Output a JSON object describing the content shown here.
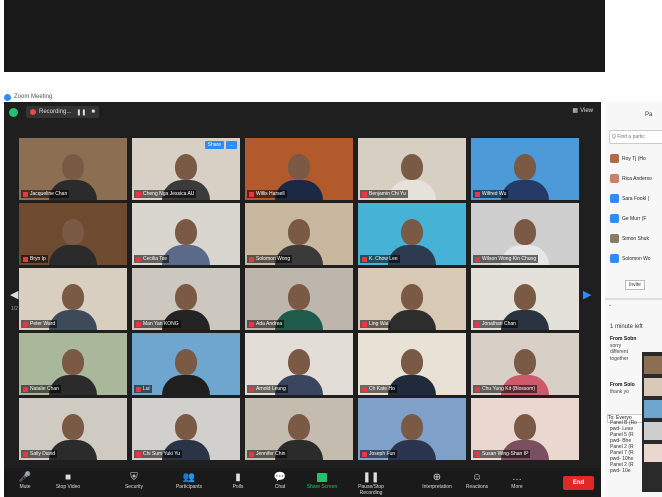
{
  "app": {
    "title": "Zoom Meeting"
  },
  "status": {
    "recording_label": "Recording...",
    "pause": "❚❚",
    "stop": "■",
    "view_label": "View"
  },
  "nav": {
    "left": "◀",
    "right": "▶",
    "page_left": "1/2"
  },
  "tile_buttons": [
    "Share",
    "…"
  ],
  "participants": [
    {
      "name": "Jacqueline Chan",
      "colors": {
        "bg": "#8c6e52",
        "body": "#2b2b2b"
      }
    },
    {
      "name": "Cheng Nga Jessica AU",
      "colors": {
        "bg": "#d8d0c4",
        "body": "#3b3b3b"
      },
      "active": true
    },
    {
      "name": "Willis Harsell",
      "colors": {
        "bg": "#b35a2c",
        "body": "#1b2944"
      }
    },
    {
      "name": "Benjamin Chi Yu",
      "colors": {
        "bg": "#d7cfc2",
        "body": "#e6e1da"
      }
    },
    {
      "name": "Wilfred Wu",
      "colors": {
        "bg": "#4c9bd8",
        "body": "#253a66"
      }
    },
    {
      "name": "Bryn Ip",
      "colors": {
        "bg": "#6e4a2f",
        "body": "#2b2b2b"
      }
    },
    {
      "name": "Cecilia Tse",
      "colors": {
        "bg": "#d9d6d0",
        "body": "#5a6a88"
      }
    },
    {
      "name": "Solomon Wong",
      "colors": {
        "bg": "#c9b8a0",
        "body": "#3a3a3a"
      }
    },
    {
      "name": "K. Chow Lee",
      "colors": {
        "bg": "#46b3d6",
        "body": "#2c3b4f"
      }
    },
    {
      "name": "Wilson Wong Kin Chung",
      "colors": {
        "bg": "#cfcfcf",
        "body": "#e6e6e6"
      }
    },
    {
      "name": "Peter Ward",
      "colors": {
        "bg": "#d9cfc0",
        "body": "#3d4a5a"
      }
    },
    {
      "name": "Man Yan KONG",
      "colors": {
        "bg": "#ccc7bf",
        "body": "#242424"
      }
    },
    {
      "name": "Ada Andrea",
      "colors": {
        "bg": "#bdb6ad",
        "body": "#1e5b4a"
      }
    },
    {
      "name": "Ling Wai",
      "colors": {
        "bg": "#d7c9b5",
        "body": "#2d2d2d"
      }
    },
    {
      "name": "Jonathan Chan",
      "colors": {
        "bg": "#e4e0da",
        "body": "#2b3340"
      }
    },
    {
      "name": "Natalie Chan",
      "colors": {
        "bg": "#a9b79a",
        "body": "#2b2b2b"
      }
    },
    {
      "name": "Lui",
      "colors": {
        "bg": "#6fa6cf",
        "body": "#1f1f1f"
      }
    },
    {
      "name": "Arnold Leung",
      "colors": {
        "bg": "#e2ddd6",
        "body": "#3a4660"
      }
    },
    {
      "name": "Ch Kate Ho",
      "colors": {
        "bg": "#e8e2d6",
        "body": "#1f2a3a"
      }
    },
    {
      "name": "Chu Yung Kit (Blossom)",
      "colors": {
        "bg": "#d8cfc6",
        "body": "#cc5a6a"
      }
    },
    {
      "name": "Sally David",
      "colors": {
        "bg": "#cfcac2",
        "body": "#2b2b2b"
      }
    },
    {
      "name": "Chi Sum Yuki Yu",
      "colors": {
        "bg": "#d2d0cc",
        "body": "#2a3446"
      }
    },
    {
      "name": "Jennifer Chin",
      "colors": {
        "bg": "#c5bcb0",
        "body": "#2b2b2b"
      }
    },
    {
      "name": "Joseph Fun",
      "colors": {
        "bg": "#7fa0c8",
        "body": "#2b3550"
      }
    },
    {
      "name": "Susan Wing-Shan IP",
      "colors": {
        "bg": "#ead8d0",
        "body": "#7a5060"
      }
    }
  ],
  "toolbar": {
    "items": [
      {
        "label": "Mute",
        "icon": "🎤"
      },
      {
        "label": "Stop Video",
        "icon": "■"
      },
      {
        "label": "Security",
        "icon": "⛨"
      },
      {
        "label": "Participants",
        "icon": "👥"
      },
      {
        "label": "Polls",
        "icon": "▮"
      },
      {
        "label": "Chat",
        "icon": "💬"
      },
      {
        "label": "Share Screen",
        "icon": "box",
        "green": true
      },
      {
        "label": "Pause/Stop Recording",
        "icon": "❚❚"
      },
      {
        "label": "Interpretation",
        "icon": "⊕"
      },
      {
        "label": "Reactions",
        "icon": "☺"
      },
      {
        "label": "More",
        "icon": "…"
      }
    ],
    "end_label": "End"
  },
  "side_panel": {
    "title": "Pa",
    "search_placeholder": "Q Find a partic",
    "items": [
      {
        "name": "Roy Tj (Ho",
        "color": "#b06a4a"
      },
      {
        "name": "Rica Anderso",
        "color": "#c9826a"
      },
      {
        "name": "Sara Fookl (",
        "color": "#2d8cff"
      },
      {
        "name": "Ge Murr (F",
        "color": "#2d8cff"
      },
      {
        "name": "Simon Shuk",
        "color": "#8a7a6a"
      },
      {
        "name": "Solomon Wo",
        "color": "#2d8cff"
      }
    ],
    "invite": "Invite",
    "time": "1 minute left",
    "chat": [
      {
        "from": "From Sobn",
        "text": "sorry different together"
      },
      {
        "from": "From Solo",
        "text": "thank yo"
      }
    ],
    "input": "To: Everyo",
    "list": [
      "Panel B (Ro",
      "pwd- Leav",
      "Panel 5 (R",
      "pwd- Bhe",
      "Panel 2 (R",
      "Panel 7 (R",
      "pwd- 10he",
      "Panel 2 (R",
      "pwd- 10e"
    ]
  }
}
